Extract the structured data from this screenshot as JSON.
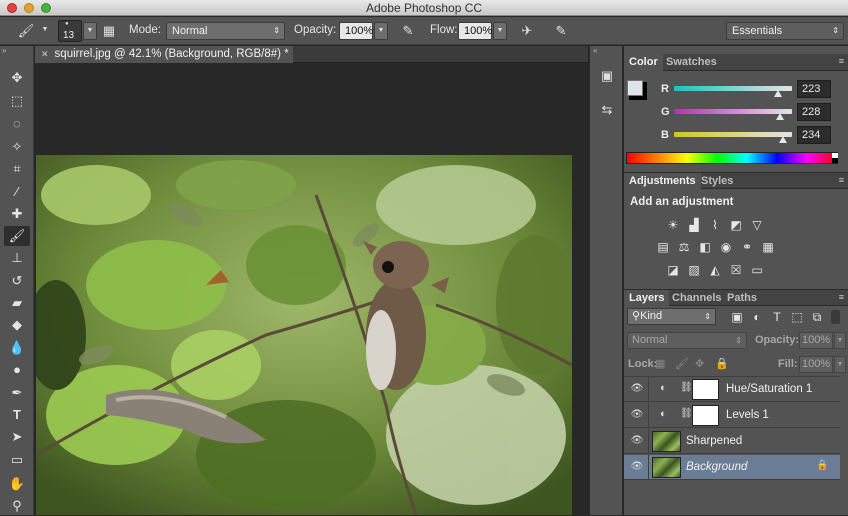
{
  "window": {
    "title": "Adobe Photoshop CC"
  },
  "options_bar": {
    "brush_size": "13",
    "mode_label": "Mode:",
    "mode_value": "Normal",
    "opacity_label": "Opacity:",
    "opacity_value": "100%",
    "flow_label": "Flow:",
    "flow_value": "100%",
    "workspace": "Essentials"
  },
  "document": {
    "tab_title": "squirrel.jpg @ 42.1% (Background, RGB/8#) *"
  },
  "color_panel": {
    "tabs": [
      "Color",
      "Swatches"
    ],
    "channels": [
      {
        "name": "R",
        "value": "223",
        "fraction": 0.875,
        "gradient": "#22c4c4"
      },
      {
        "name": "G",
        "value": "228",
        "fraction": 0.894,
        "gradient": "#d43cd4"
      },
      {
        "name": "B",
        "value": "234",
        "fraction": 0.918,
        "gradient": "#d8d23c"
      }
    ],
    "foreground": "#dfe4ea",
    "background": "#000000"
  },
  "adjustments_panel": {
    "tabs": [
      "Adjustments",
      "Styles"
    ],
    "heading": "Add an adjustment"
  },
  "layers_panel": {
    "tabs": [
      "Layers",
      "Channels",
      "Paths"
    ],
    "filter_kind": "Kind",
    "blend_mode": "Normal",
    "opacity_label": "Opacity:",
    "opacity_value": "100%",
    "lock_label": "Lock:",
    "fill_label": "Fill:",
    "fill_value": "100%",
    "layers": [
      {
        "name": "Hue/Saturation 1",
        "type": "adjustment"
      },
      {
        "name": "Levels 1",
        "type": "adjustment"
      },
      {
        "name": "Sharpened",
        "type": "image"
      },
      {
        "name": "Background",
        "type": "image",
        "selected": true,
        "locked": true
      }
    ]
  }
}
